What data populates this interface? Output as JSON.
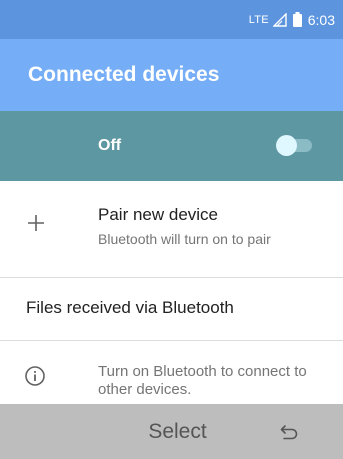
{
  "status_bar": {
    "network_label": "LTE",
    "signal_icon": "signal-icon",
    "battery_icon": "battery-icon",
    "time": "6:03"
  },
  "app_bar": {
    "title": "Connected devices"
  },
  "bluetooth_toggle": {
    "label": "Off",
    "state": "off",
    "icon": "toggle-switch"
  },
  "items": {
    "pair_new_device": {
      "icon": "plus-icon",
      "title": "Pair new device",
      "subtitle": "Bluetooth will turn on to pair"
    },
    "files_received": {
      "title": "Files received via Bluetooth"
    },
    "info": {
      "icon": "info-icon",
      "text": "Turn on Bluetooth to connect to other devices."
    }
  },
  "softkeys": {
    "center_label": "Select",
    "right_icon": "back-icon"
  },
  "colors": {
    "status_bar": "#5c95de",
    "app_bar": "#75aef7",
    "toggle_row": "#5d97a2",
    "softkey_bar": "#bdbdbd"
  }
}
